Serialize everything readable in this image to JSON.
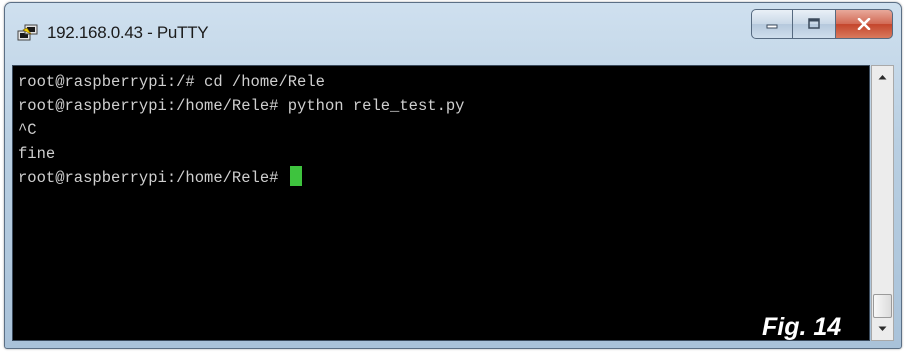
{
  "window": {
    "title": "192.168.0.43 - PuTTY",
    "icon": "putty-icon",
    "controls": {
      "minimize": "minimize-icon",
      "maximize": "maximize-icon",
      "close": "close-icon"
    }
  },
  "terminal": {
    "lines": [
      "root@raspberrypi:/# cd /home/Rele",
      "root@raspberrypi:/home/Rele# python rele_test.py",
      "^C",
      "fine",
      "root@raspberrypi:/home/Rele# "
    ],
    "text_color": "#cfcfcf",
    "background": "#000000",
    "cursor_color": "#3ec33e"
  },
  "figure_label": "Fig. 14"
}
